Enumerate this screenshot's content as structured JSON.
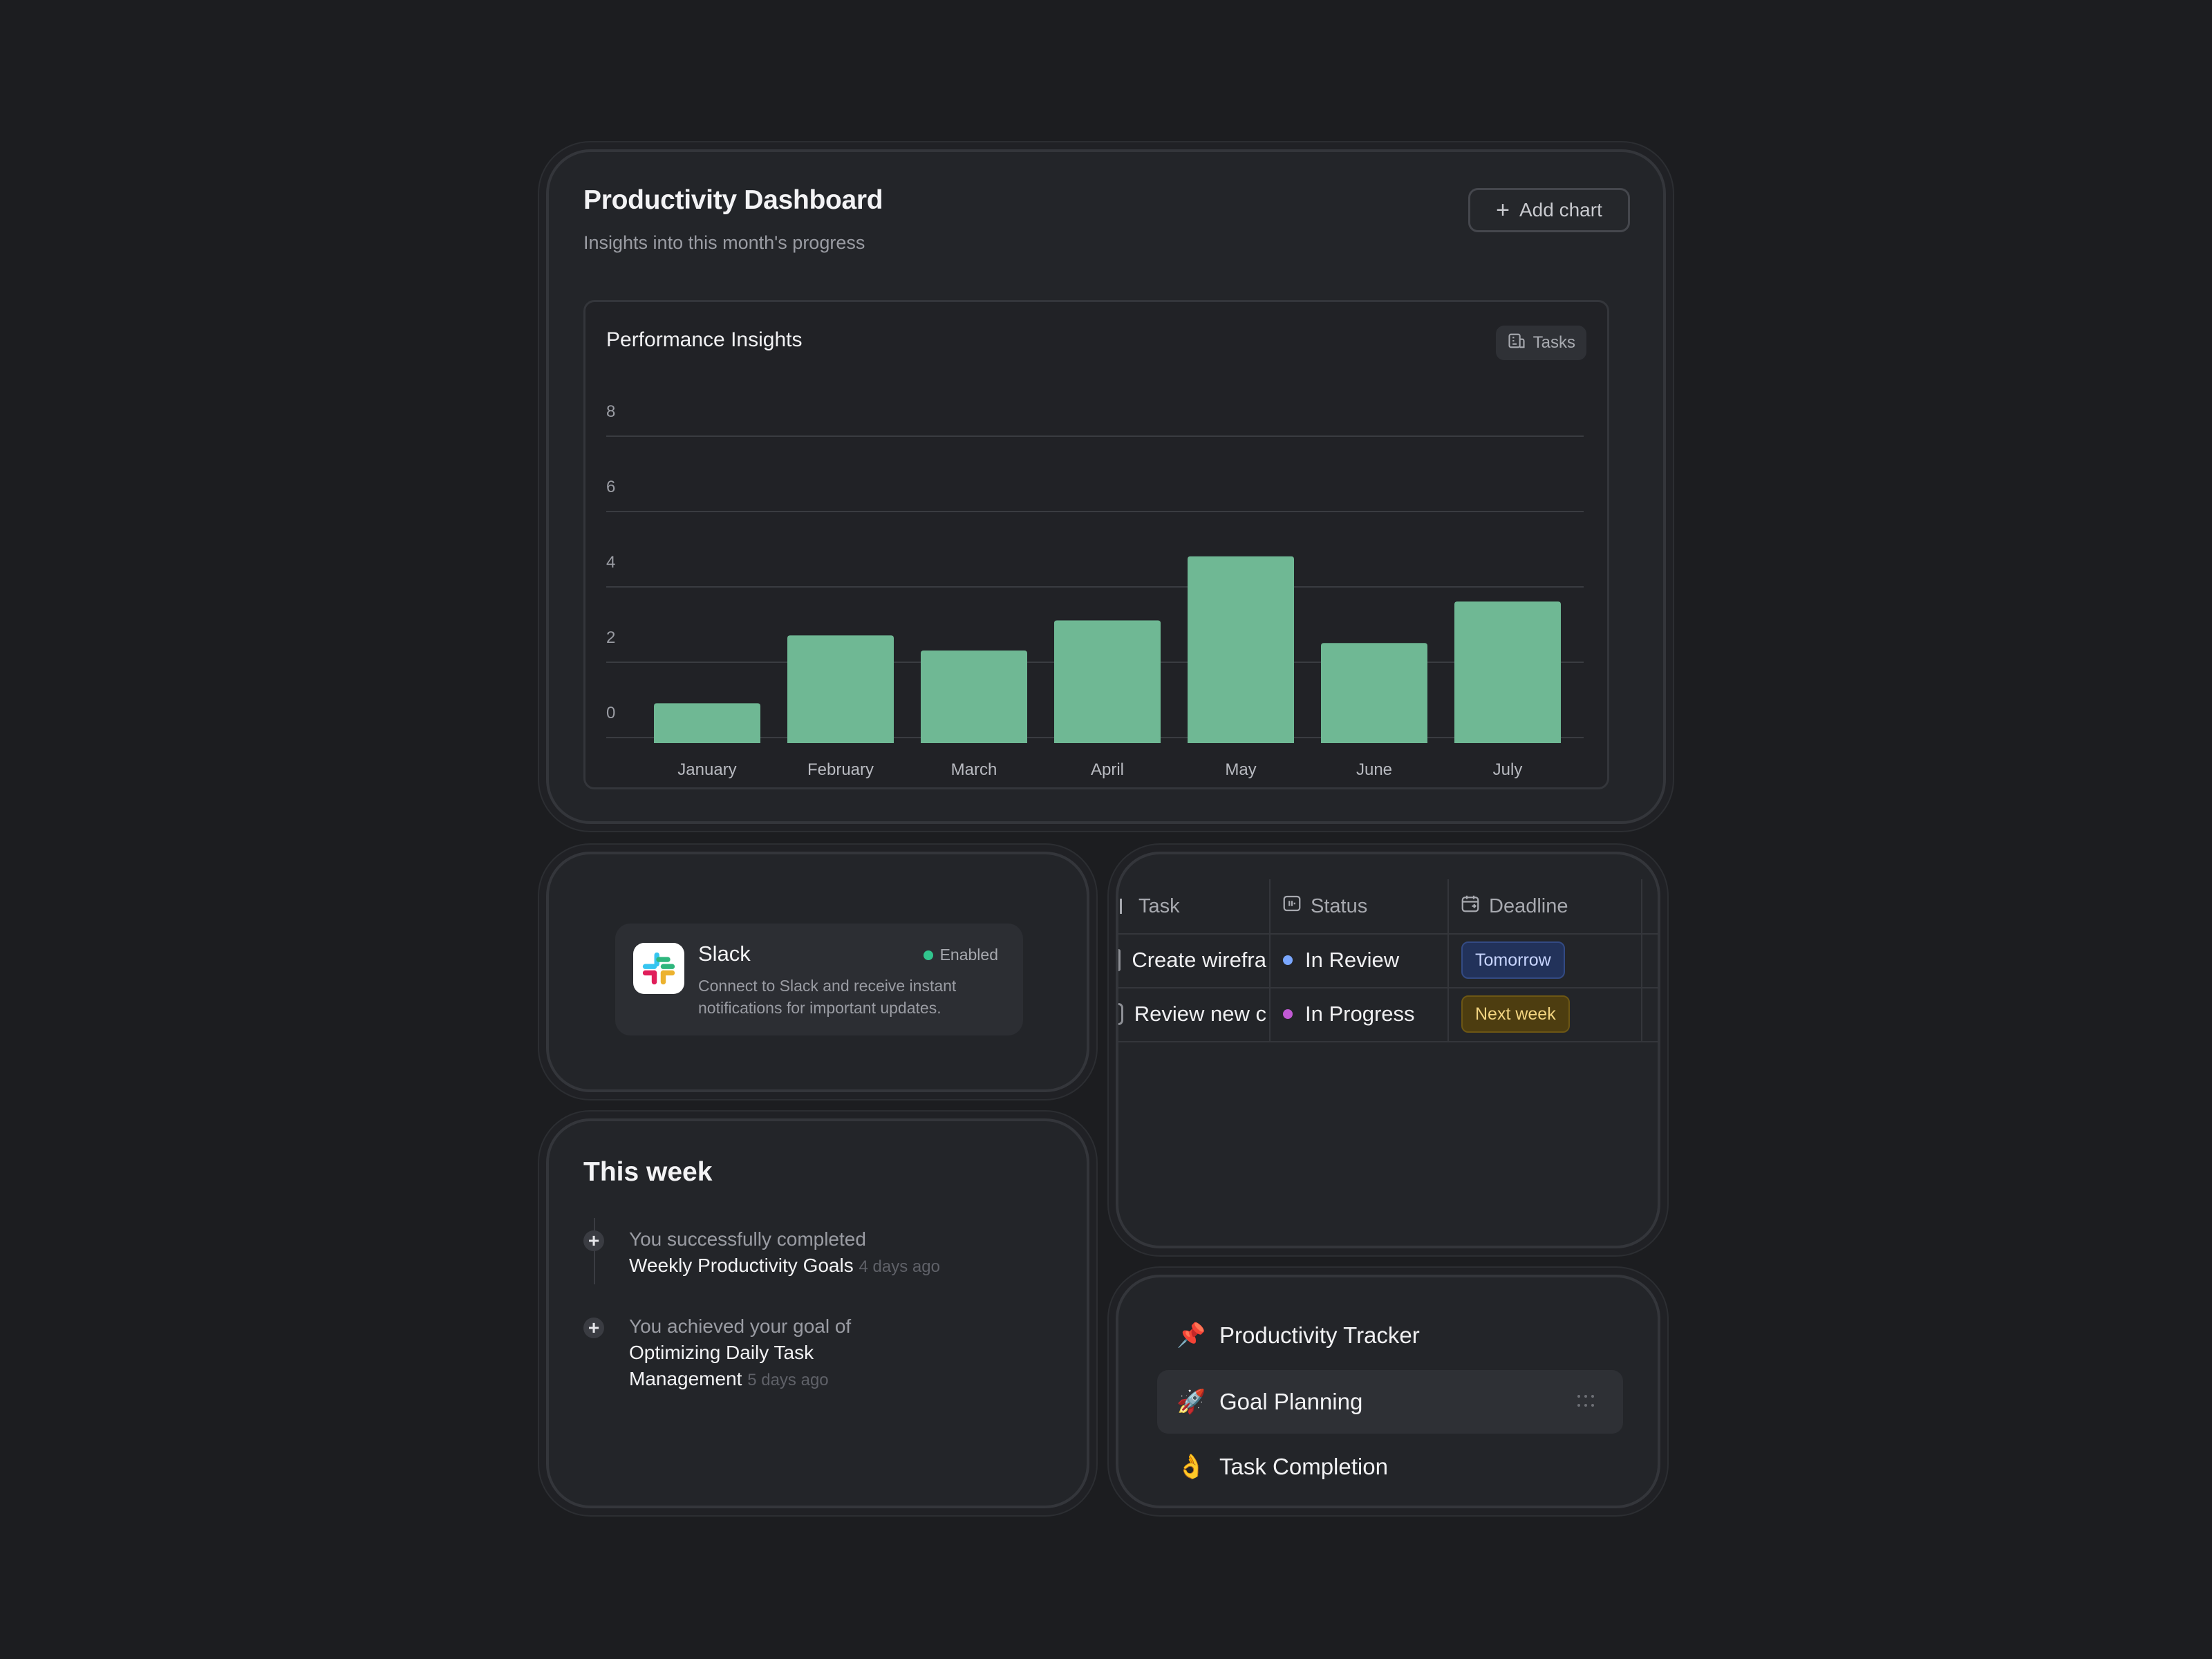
{
  "dashboard": {
    "title": "Productivity Dashboard",
    "subtitle": "Insights into this month's progress",
    "add_chart_label": "Add chart",
    "add_chart_icon": "plus-icon",
    "panel_title": "Performance Insights",
    "badge_label": "Tasks",
    "badge_icon": "building-icon"
  },
  "chart_data": {
    "type": "bar",
    "title": "Performance Insights",
    "categories": [
      "January",
      "February",
      "March",
      "April",
      "May",
      "June",
      "July"
    ],
    "values": [
      0.8,
      2.6,
      2.2,
      3.0,
      4.7,
      2.4,
      3.5
    ],
    "yticks": [
      "0",
      "2",
      "4",
      "6",
      "8"
    ],
    "ylim": [
      0,
      8
    ],
    "grid": true,
    "bar_color": "#6fb894",
    "xlabel": "",
    "ylabel": ""
  },
  "slack": {
    "name": "Slack",
    "status": "Enabled",
    "status_color": "#31c48d",
    "description": "Connect to Slack and receive instant notifications for important updates.",
    "logo_icon": "slack-logo-icon"
  },
  "this_week": {
    "title": "This week",
    "items": [
      {
        "prefix": "You successfully completed",
        "highlight": "Weekly Productivity Goals",
        "time": "4 days ago"
      },
      {
        "prefix": "You achieved your goal of",
        "highlight": "Optimizing Daily Task Management",
        "time": "5 days ago"
      }
    ]
  },
  "tasks_table": {
    "headers": {
      "task": "Task",
      "status": "Status",
      "deadline": "Deadline"
    },
    "rows": [
      {
        "task": "Create wirefra",
        "status": "In Review",
        "status_color": "#7aa7ff",
        "deadline": "Tomorrow",
        "deadline_style": "blue"
      },
      {
        "task": "Review new c",
        "status": "In Progress",
        "status_color": "#c15ad4",
        "deadline": "Next week",
        "deadline_style": "amber"
      }
    ]
  },
  "lists": {
    "items": [
      {
        "emoji": "📌",
        "label": "Productivity Tracker"
      },
      {
        "emoji": "🚀",
        "label": "Goal Planning"
      },
      {
        "emoji": "👌",
        "label": "Task Completion"
      }
    ]
  }
}
